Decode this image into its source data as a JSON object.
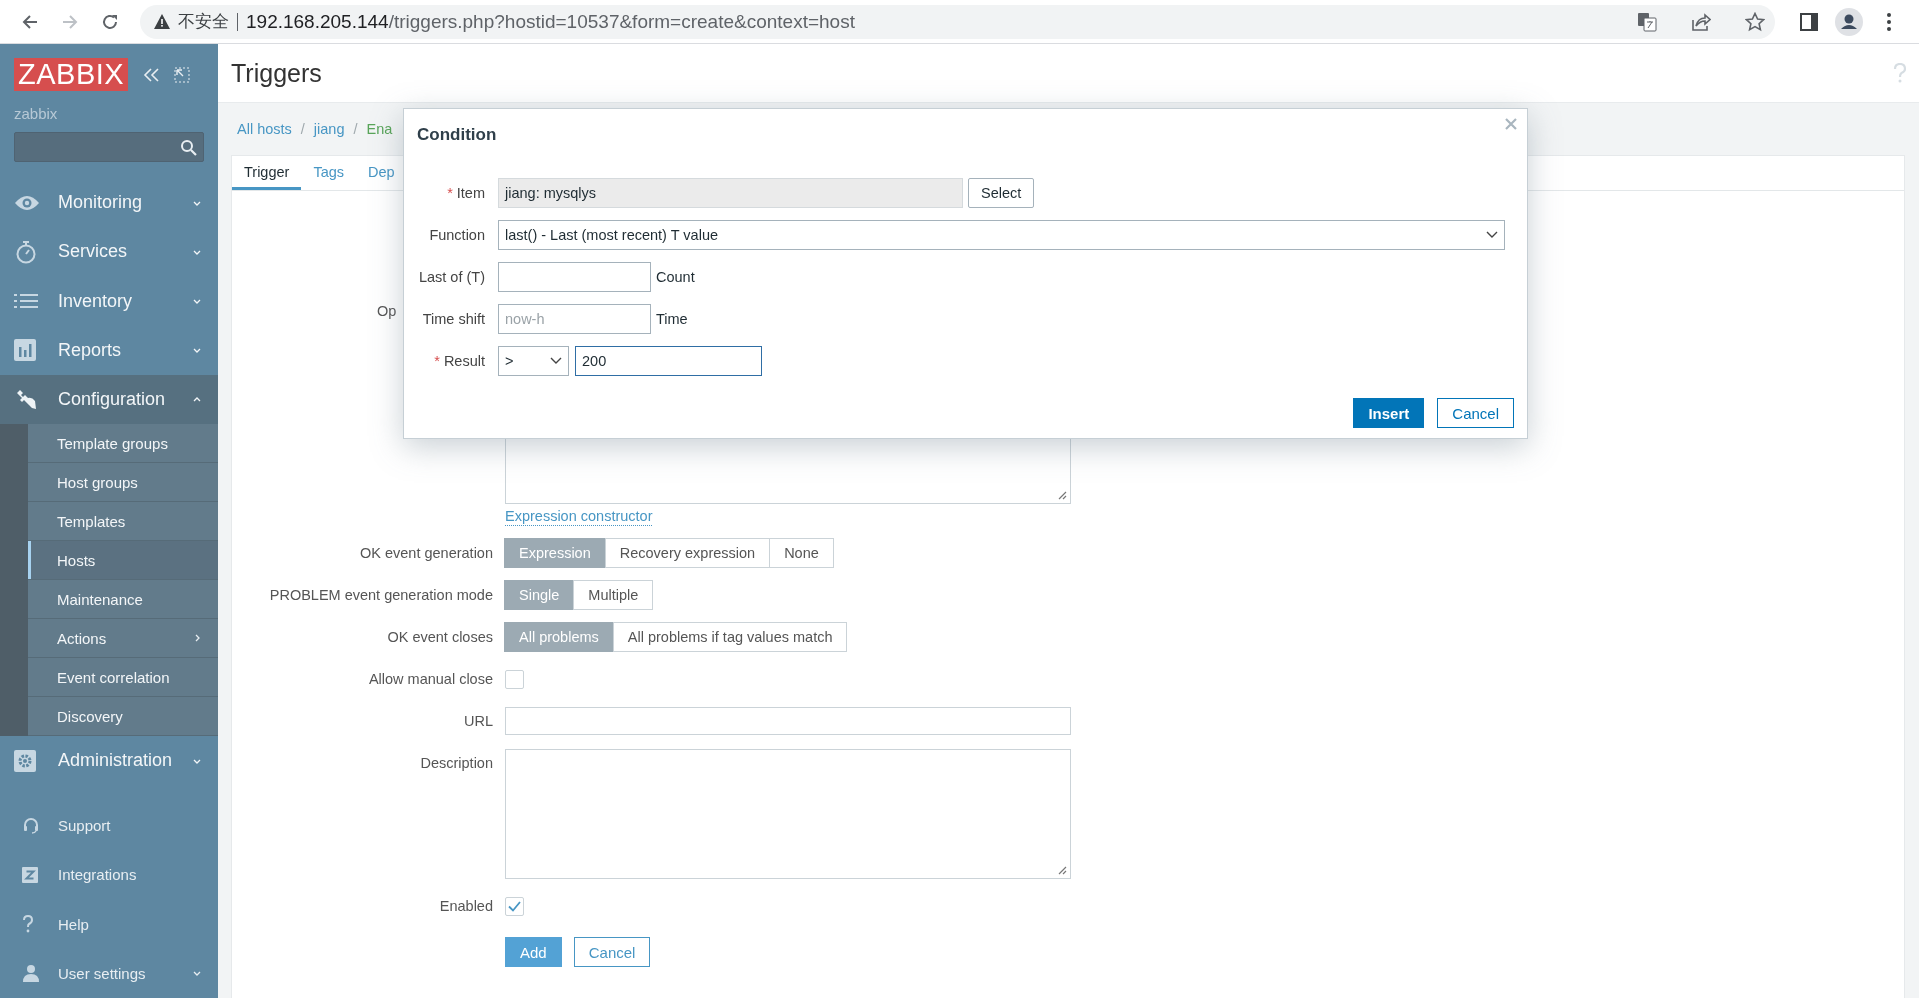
{
  "browser": {
    "security_label": "不安全",
    "url_host": "192.168.205.144",
    "url_path": "/triggers.php?hostid=10537&form=create&context=host"
  },
  "sidebar": {
    "logo": "ZABBIX",
    "server_name": "zabbix",
    "menu": [
      {
        "label": "Monitoring",
        "expanded": false
      },
      {
        "label": "Services",
        "expanded": false
      },
      {
        "label": "Inventory",
        "expanded": false
      },
      {
        "label": "Reports",
        "expanded": false
      },
      {
        "label": "Configuration",
        "expanded": true,
        "children": [
          {
            "label": "Template groups",
            "selected": false,
            "has_submenu": false
          },
          {
            "label": "Host groups",
            "selected": false,
            "has_submenu": false
          },
          {
            "label": "Templates",
            "selected": false,
            "has_submenu": false
          },
          {
            "label": "Hosts",
            "selected": true,
            "has_submenu": false
          },
          {
            "label": "Maintenance",
            "selected": false,
            "has_submenu": false
          },
          {
            "label": "Actions",
            "selected": false,
            "has_submenu": true
          },
          {
            "label": "Event correlation",
            "selected": false,
            "has_submenu": false
          },
          {
            "label": "Discovery",
            "selected": false,
            "has_submenu": false
          }
        ]
      },
      {
        "label": "Administration",
        "expanded": false
      }
    ],
    "bottom_menu": [
      {
        "label": "Support",
        "has_submenu": false
      },
      {
        "label": "Integrations",
        "has_submenu": false
      },
      {
        "label": "Help",
        "has_submenu": false
      },
      {
        "label": "User settings",
        "has_submenu": true
      }
    ]
  },
  "page": {
    "title": "Triggers",
    "breadcrumbs": [
      {
        "label": "All hosts",
        "kind": "link"
      },
      {
        "separator": "/",
        "label": "jiang",
        "kind": "link"
      },
      {
        "separator": "/",
        "label": "Ena",
        "kind": "status"
      }
    ],
    "tabs": [
      {
        "label": "Trigger",
        "selected": true
      },
      {
        "label": "Tags",
        "selected": false
      },
      {
        "label": "Dep",
        "selected": false
      }
    ]
  },
  "form": {
    "cut_label": "Op",
    "expression_link": "Expression constructor",
    "rows": [
      {
        "kind": "segmented",
        "label": "OK event generation",
        "options": [
          {
            "label": "Expression",
            "selected": true
          },
          {
            "label": "Recovery expression",
            "selected": false
          },
          {
            "label": "None",
            "selected": false
          }
        ]
      },
      {
        "kind": "segmented",
        "label": "PROBLEM event generation mode",
        "options": [
          {
            "label": "Single",
            "selected": true
          },
          {
            "label": "Multiple",
            "selected": false
          }
        ]
      },
      {
        "kind": "segmented",
        "label": "OK event closes",
        "options": [
          {
            "label": "All problems",
            "selected": true
          },
          {
            "label": "All problems if tag values match",
            "selected": false
          }
        ]
      },
      {
        "kind": "checkbox",
        "label": "Allow manual close",
        "checked": false
      },
      {
        "kind": "input",
        "label": "URL"
      },
      {
        "kind": "textarea",
        "label": "Description"
      },
      {
        "kind": "checkbox",
        "label": "Enabled",
        "checked": true
      }
    ],
    "buttons": [
      {
        "label": "Add",
        "kind": "primary"
      },
      {
        "label": "Cancel",
        "kind": "secondary"
      }
    ]
  },
  "dialog": {
    "title": "Condition",
    "rows": [
      {
        "kind": "item",
        "label": "Item",
        "required_mark": "*",
        "value": "jiang: mysqlys",
        "button": "Select"
      },
      {
        "kind": "select",
        "label": "Function",
        "value": "last() - Last (most recent) T value"
      },
      {
        "kind": "input",
        "label": "Last of (T)",
        "suffix": "Count"
      },
      {
        "kind": "input",
        "label": "Time shift",
        "placeholder": "now-h",
        "suffix": "Time"
      },
      {
        "kind": "result",
        "label": "Result",
        "required_mark": "*",
        "operator": ">",
        "value": "200"
      }
    ],
    "buttons": [
      {
        "label": "Insert",
        "kind": "primary"
      },
      {
        "label": "Cancel",
        "kind": "secondary"
      }
    ]
  }
}
